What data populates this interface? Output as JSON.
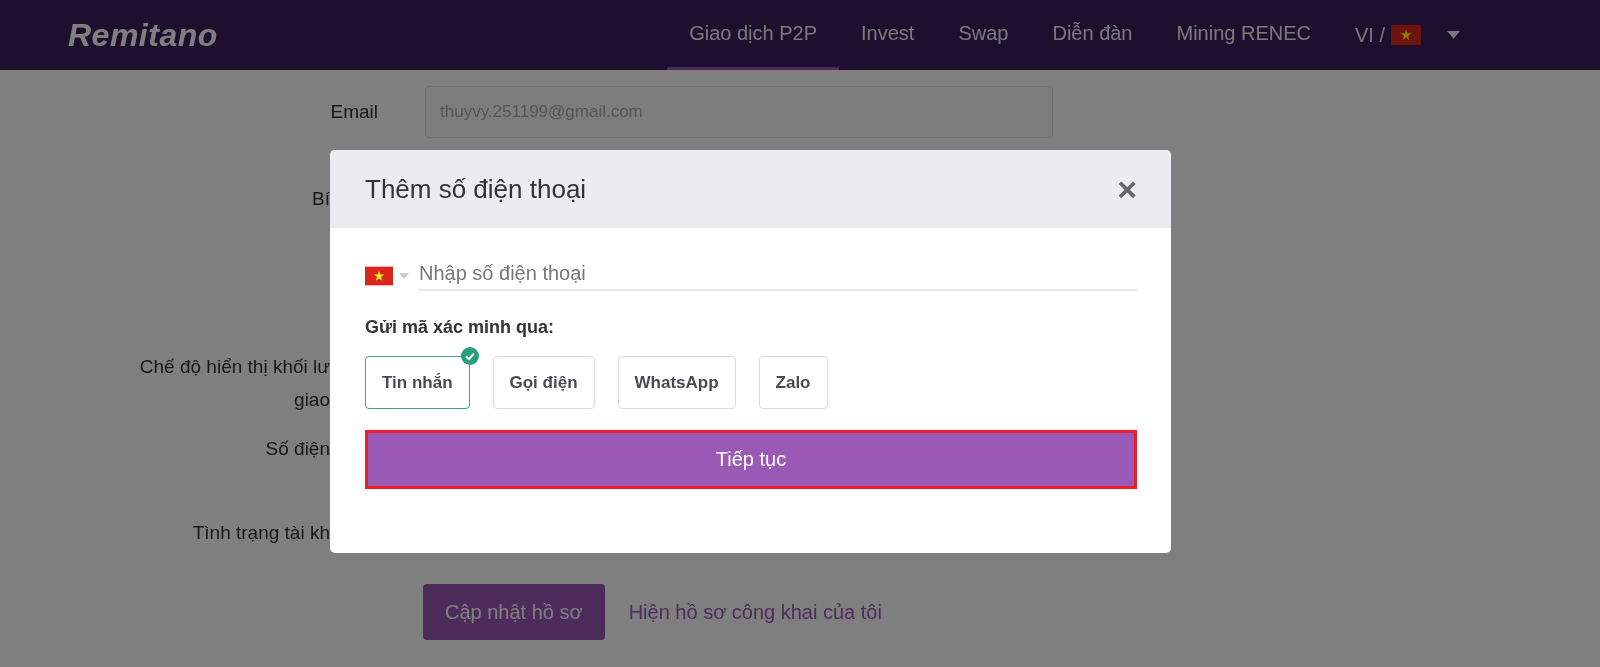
{
  "header": {
    "logo": "Remitano",
    "nav": [
      {
        "label": "Giao dịch P2P",
        "selected": true
      },
      {
        "label": "Invest",
        "selected": false
      },
      {
        "label": "Swap",
        "selected": false
      },
      {
        "label": "Diễn đàn",
        "selected": false
      },
      {
        "label": "Mining RENEC",
        "selected": false
      }
    ],
    "language": "VI /"
  },
  "profile": {
    "email_label": "Email",
    "email_value": "thuyvy.251199@gmail.com",
    "covered_rows": [
      {
        "lines": [
          "Bí"
        ]
      },
      {
        "lines": [
          "Chế độ hiển thị khối lư",
          "giao"
        ]
      },
      {
        "lines": [
          "Số điện"
        ]
      },
      {
        "lines": [
          "Tình trạng tài kh"
        ]
      }
    ],
    "update_button": "Cập nhật hồ sơ",
    "public_profile_link": "Hiện hồ sơ công khai của tôi"
  },
  "dialog": {
    "title": "Thêm số điện thoại",
    "close": "×",
    "phone_placeholder": "Nhập số điện thoại",
    "method_label": "Gửi mã xác minh qua:",
    "options": [
      {
        "label": "Tin nhắn",
        "selected": true
      },
      {
        "label": "Gọi điện",
        "selected": false
      },
      {
        "label": "WhatsApp",
        "selected": false
      },
      {
        "label": "Zalo",
        "selected": false
      }
    ],
    "continue_button": "Tiếp tục"
  }
}
